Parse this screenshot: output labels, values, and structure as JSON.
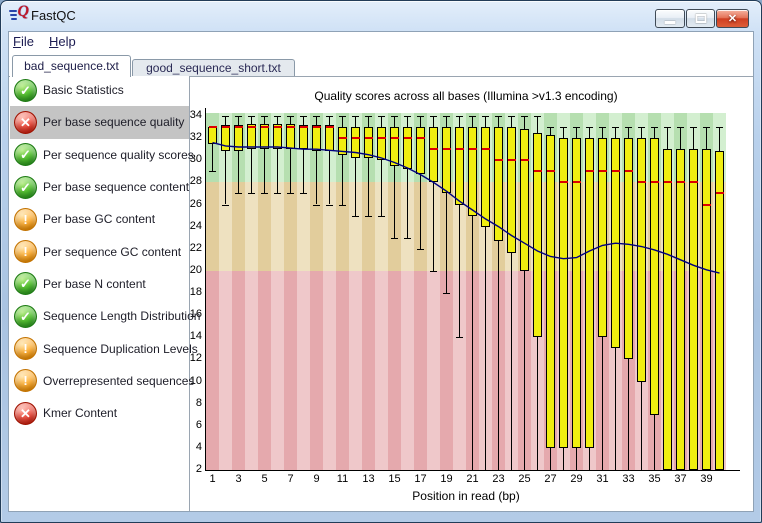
{
  "window": {
    "title": "FastQC",
    "controls": [
      {
        "name": "minimize"
      },
      {
        "name": "maximize"
      },
      {
        "name": "close",
        "glyph": "✕"
      }
    ]
  },
  "menu": {
    "items": [
      {
        "label": "File"
      },
      {
        "label": "Help"
      }
    ]
  },
  "tabs": [
    {
      "label": "bad_sequence.txt",
      "active": true
    },
    {
      "label": "good_sequence_short.txt",
      "active": false
    }
  ],
  "sidebar": {
    "items": [
      {
        "label": "Basic Statistics",
        "status": "pass",
        "selected": false
      },
      {
        "label": "Per base sequence quality",
        "status": "fail",
        "selected": true
      },
      {
        "label": "Per sequence quality scores",
        "status": "pass",
        "selected": false
      },
      {
        "label": "Per base sequence content",
        "status": "pass",
        "selected": false
      },
      {
        "label": "Per base GC content",
        "status": "warn",
        "selected": false
      },
      {
        "label": "Per sequence GC content",
        "status": "warn",
        "selected": false
      },
      {
        "label": "Per base N content",
        "status": "pass",
        "selected": false
      },
      {
        "label": "Sequence Length Distribution",
        "status": "pass",
        "selected": false
      },
      {
        "label": "Sequence Duplication Levels",
        "status": "warn",
        "selected": false
      },
      {
        "label": "Overrepresented sequences",
        "status": "warn",
        "selected": false
      },
      {
        "label": "Kmer Content",
        "status": "fail",
        "selected": false
      }
    ],
    "status_glyphs": {
      "pass": "✓",
      "warn": "!",
      "fail": "✕"
    },
    "status_colors": {
      "pass": "#2b9c1e",
      "warn": "#f08f00",
      "fail": "#d01f0e"
    },
    "selected_bg": "#c4c4c4"
  },
  "chart_data": {
    "type": "boxplot",
    "title": "Quality scores across all bases (Illumina >v1.3 encoding)",
    "xlabel": "Position in read (bp)",
    "ylim": [
      2,
      34
    ],
    "grid": false,
    "positions": [
      1,
      2,
      3,
      4,
      5,
      6,
      7,
      8,
      9,
      10,
      11,
      12,
      13,
      14,
      15,
      16,
      17,
      18,
      19,
      20,
      21,
      22,
      23,
      24,
      25,
      26,
      27,
      28,
      29,
      30,
      31,
      32,
      33,
      34,
      35,
      36,
      37,
      38,
      39,
      40
    ],
    "x_tick_labels": [
      1,
      3,
      5,
      7,
      9,
      11,
      13,
      15,
      17,
      19,
      21,
      23,
      25,
      27,
      29,
      31,
      33,
      35,
      37,
      39
    ],
    "y_ticks": [
      2,
      4,
      6,
      8,
      10,
      12,
      14,
      16,
      18,
      20,
      22,
      24,
      26,
      28,
      30,
      32,
      34
    ],
    "zones": [
      {
        "name": "good",
        "from": 28,
        "to": 35,
        "color_dark": "#b6dfb0",
        "color_light": "#d3efd0"
      },
      {
        "name": "ok",
        "from": 20,
        "to": 28,
        "color_dark": "#e2cd9c",
        "color_light": "#eee1c0"
      },
      {
        "name": "bad",
        "from": 2,
        "to": 20,
        "color_dark": "#e5a9ad",
        "color_light": "#efc8ca"
      }
    ],
    "series": {
      "lower_whisker": [
        29,
        26,
        27,
        27,
        27,
        27,
        27,
        27,
        26,
        26,
        26,
        25,
        25,
        25,
        23,
        23,
        22,
        20,
        18,
        14,
        2,
        2,
        2,
        2,
        2,
        2,
        2,
        2,
        2,
        2,
        2,
        2,
        2,
        2,
        2,
        2,
        2,
        2,
        2,
        2
      ],
      "lower_quartile": [
        31.5,
        30.8,
        30.8,
        31,
        31,
        31,
        31,
        31,
        30.8,
        30.8,
        30.5,
        30.2,
        30.2,
        30,
        29.5,
        29.2,
        28.8,
        28,
        27,
        26,
        25,
        24,
        22.7,
        21.6,
        20,
        14,
        4,
        4,
        4,
        4,
        14,
        13,
        12,
        10,
        7,
        2,
        2,
        2,
        2,
        2
      ],
      "median": [
        33,
        33,
        33,
        33,
        33,
        33,
        33,
        33,
        33,
        33,
        32,
        32,
        32,
        32,
        32,
        32,
        32,
        31,
        31,
        31,
        31,
        31,
        30,
        30,
        30,
        29,
        29,
        28,
        28,
        29,
        29,
        29,
        29,
        28,
        28,
        28,
        28,
        28,
        26,
        27
      ],
      "upper_quartile": [
        33,
        33.2,
        33.2,
        33.3,
        33.3,
        33.3,
        33.3,
        33.2,
        33.2,
        33.2,
        33,
        33,
        33,
        33,
        33,
        33,
        33,
        33,
        33,
        33,
        33,
        33,
        33,
        33,
        32.8,
        32.5,
        32.3,
        32,
        32,
        32,
        32,
        32,
        32,
        32,
        32,
        31,
        31,
        31,
        31,
        30.8
      ],
      "upper_whisker": [
        33,
        34,
        34,
        34,
        34,
        34,
        34,
        34,
        34,
        34,
        34,
        34,
        34,
        34,
        34,
        34,
        34,
        34,
        34,
        34,
        34,
        34,
        34,
        34,
        34,
        34,
        33,
        33,
        33,
        33,
        33,
        33,
        33,
        33,
        33,
        33,
        33,
        33,
        33,
        33
      ],
      "mean": [
        31.6,
        31.3,
        31.2,
        31.2,
        31.2,
        31.2,
        31.1,
        31,
        31,
        30.9,
        30.8,
        30.7,
        30.5,
        30.2,
        29.8,
        29.3,
        28.7,
        28,
        27.2,
        26.3,
        25.5,
        24.7,
        24,
        23.2,
        22.5,
        21.8,
        21.3,
        21.1,
        21.2,
        21.8,
        22.3,
        22.5,
        22.4,
        22.2,
        21.9,
        21.5,
        21,
        20.5,
        20.1,
        19.8
      ]
    },
    "colors": {
      "box": "#f0ee10",
      "box_border": "#000000",
      "median": "#dc0000",
      "mean": "#000080",
      "axis": "#000000"
    }
  }
}
